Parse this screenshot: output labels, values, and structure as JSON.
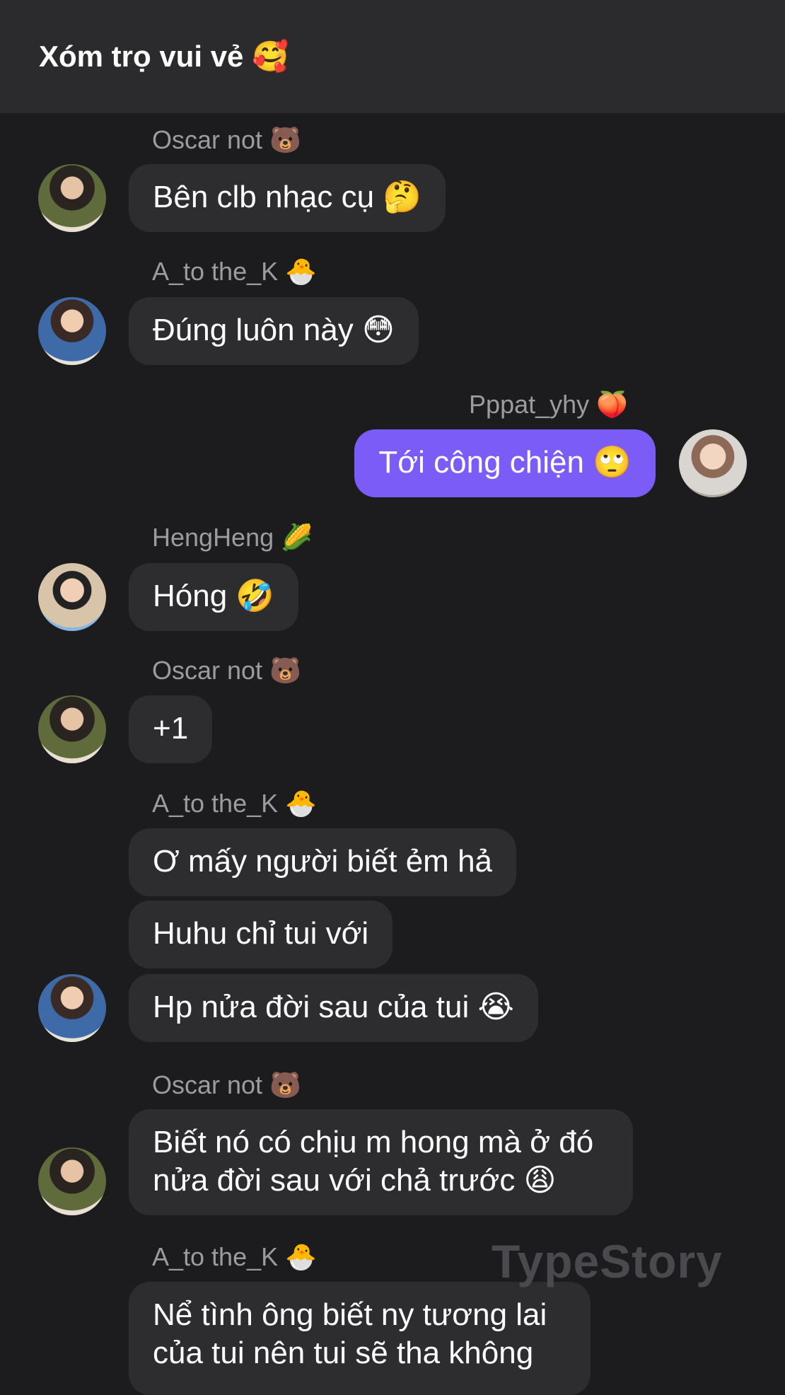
{
  "header": {
    "title": "Xóm trọ vui vẻ 🥰"
  },
  "messages": [
    {
      "sender": "Oscar not 🐻",
      "avatar": "avatar-oscar",
      "texts": [
        "Bên clb nhạc cụ 🤔"
      ]
    },
    {
      "sender": "A_to the_K 🐣",
      "avatar": "avatar-a-to-the-k",
      "texts": [
        "Đúng luôn này 😳"
      ]
    },
    {
      "sender": "Pppat_yhy 🍑",
      "avatar": "avatar-pppat-yhy",
      "texts": [
        "Tới công chiện 🙄"
      ]
    },
    {
      "sender": "HengHeng 🌽",
      "avatar": "avatar-hengheng",
      "texts": [
        "Hóng 🤣"
      ]
    },
    {
      "sender": "Oscar not 🐻",
      "avatar": "avatar-oscar",
      "texts": [
        "+1"
      ]
    },
    {
      "sender": "A_to the_K 🐣",
      "avatar": "avatar-a-to-the-k",
      "texts": [
        "Ơ mấy người biết ẻm hả",
        "Huhu chỉ tui với",
        "Hp nửa đời sau của tui 😭"
      ]
    },
    {
      "sender": "Oscar not 🐻",
      "avatar": "avatar-oscar",
      "texts": [
        "Biết nó có chịu m hong mà ở đó",
        "nửa đời sau với chả trước 😩"
      ]
    },
    {
      "sender": "A_to the_K 🐣",
      "avatar": "avatar-a-to-the-k",
      "texts": [
        "Nể tình ông biết ny tương lai",
        "của tui nên tui sẽ tha không"
      ]
    }
  ],
  "watermark": "TypeStory",
  "colors": {
    "background": "#1c1c1e",
    "header": "#2b2b2d",
    "bubble_incoming": "#2d2d30",
    "bubble_outgoing": "#7c5cf6",
    "sender_text": "#9c9c9f"
  }
}
